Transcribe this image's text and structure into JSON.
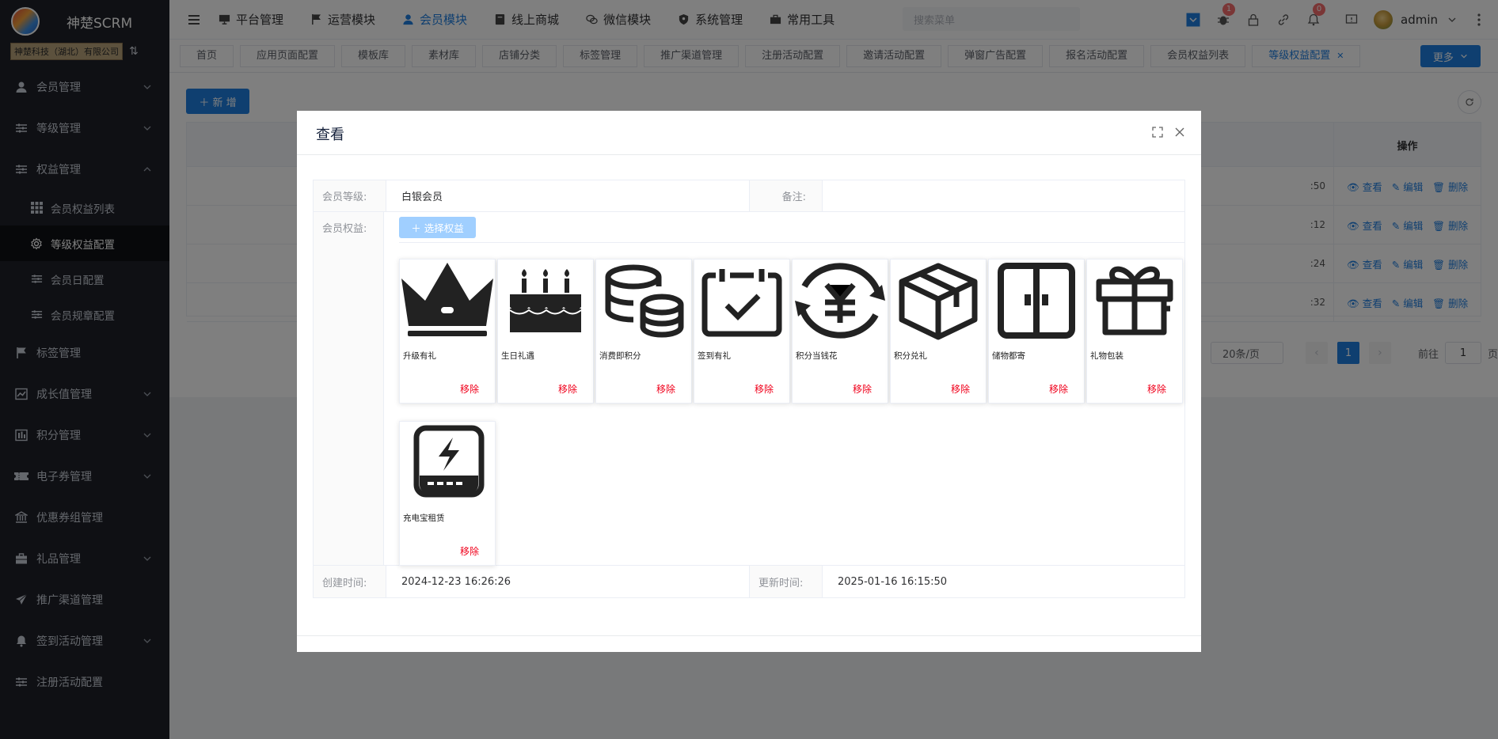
{
  "app": {
    "title": "神楚SCRM",
    "company": "神楚科技（湖北）有限公司"
  },
  "sidebar": {
    "items": [
      {
        "label": "会员管理",
        "icon": "user-icon",
        "expandable": true
      },
      {
        "label": "等级管理",
        "icon": "sliders-icon",
        "expandable": true
      },
      {
        "label": "权益管理",
        "icon": "sliders-icon",
        "expandable": true,
        "expanded": true
      },
      {
        "label": "标签管理",
        "icon": "flag-icon",
        "expandable": false
      },
      {
        "label": "成长值管理",
        "icon": "chart-icon",
        "expandable": true
      },
      {
        "label": "积分管理",
        "icon": "bar-icon",
        "expandable": true
      },
      {
        "label": "电子券管理",
        "icon": "ticket-icon",
        "expandable": true
      },
      {
        "label": "优惠券组管理",
        "icon": "bank-icon",
        "expandable": false
      },
      {
        "label": "礼品管理",
        "icon": "briefcase-icon",
        "expandable": true
      },
      {
        "label": "推广渠道管理",
        "icon": "send-icon",
        "expandable": false
      },
      {
        "label": "签到活动管理",
        "icon": "bell-icon",
        "expandable": true
      },
      {
        "label": "注册活动配置",
        "icon": "sliders-icon",
        "expandable": false
      }
    ],
    "subitems": [
      {
        "label": "会员权益列表",
        "icon": "grid-icon"
      },
      {
        "label": "等级权益配置",
        "icon": "gear-icon",
        "active": true
      },
      {
        "label": "会员日配置",
        "icon": "sliders-icon"
      },
      {
        "label": "会员规章配置",
        "icon": "sliders-icon"
      }
    ]
  },
  "header": {
    "nav": [
      {
        "label": "平台管理"
      },
      {
        "label": "运营模块"
      },
      {
        "label": "会员模块",
        "active": true
      },
      {
        "label": "线上商城"
      },
      {
        "label": "微信模块"
      },
      {
        "label": "系统管理"
      },
      {
        "label": "常用工具"
      }
    ],
    "search_placeholder": "搜索菜单",
    "bug_badge": "1",
    "bell_badge": "0",
    "user": "admin"
  },
  "tags": {
    "items": [
      "首页",
      "应用页面配置",
      "模板库",
      "素材库",
      "店铺分类",
      "标签管理",
      "推广渠道管理",
      "注册活动配置",
      "邀请活动配置",
      "弹窗广告配置",
      "报名活动配置",
      "会员权益列表",
      "等级权益配置"
    ],
    "active_index": 12,
    "more": "更多"
  },
  "main": {
    "add_label": "新 增",
    "op_header": "操作",
    "rows": [
      ":50",
      ":12",
      ":24",
      ":32"
    ],
    "ops": {
      "view": "查看",
      "edit": "编辑",
      "delete": "删除"
    },
    "pager": {
      "size": "20条/页",
      "current": "1",
      "goto": "前往",
      "goto_value": "1",
      "page_unit": "页"
    }
  },
  "dialog": {
    "title": "查看",
    "level_label": "会员等级:",
    "level_value": "白银会员",
    "remark_label": "备注:",
    "remark_value": "",
    "rights_label": "会员权益:",
    "select_btn": "选择权益",
    "remove_label": "移除",
    "rights": [
      {
        "name": "升级有礼",
        "icon": "crown-icon"
      },
      {
        "name": "生日礼遇",
        "icon": "cake-icon"
      },
      {
        "name": "消费即积分",
        "icon": "coins-icon"
      },
      {
        "name": "签到有礼",
        "icon": "calendar-check-icon"
      },
      {
        "name": "积分当钱花",
        "icon": "currency-exchange-icon"
      },
      {
        "name": "积分兑礼",
        "icon": "box-icon"
      },
      {
        "name": "储物都寄",
        "icon": "cabinet-icon"
      },
      {
        "name": "礼物包装",
        "icon": "gift-icon"
      },
      {
        "name": "充电宝租赁",
        "icon": "powerbank-icon"
      }
    ],
    "created_label": "创建时间:",
    "created_value": "2024-12-23 16:26:26",
    "updated_label": "更新时间:",
    "updated_value": "2025-01-16 16:15:50"
  }
}
